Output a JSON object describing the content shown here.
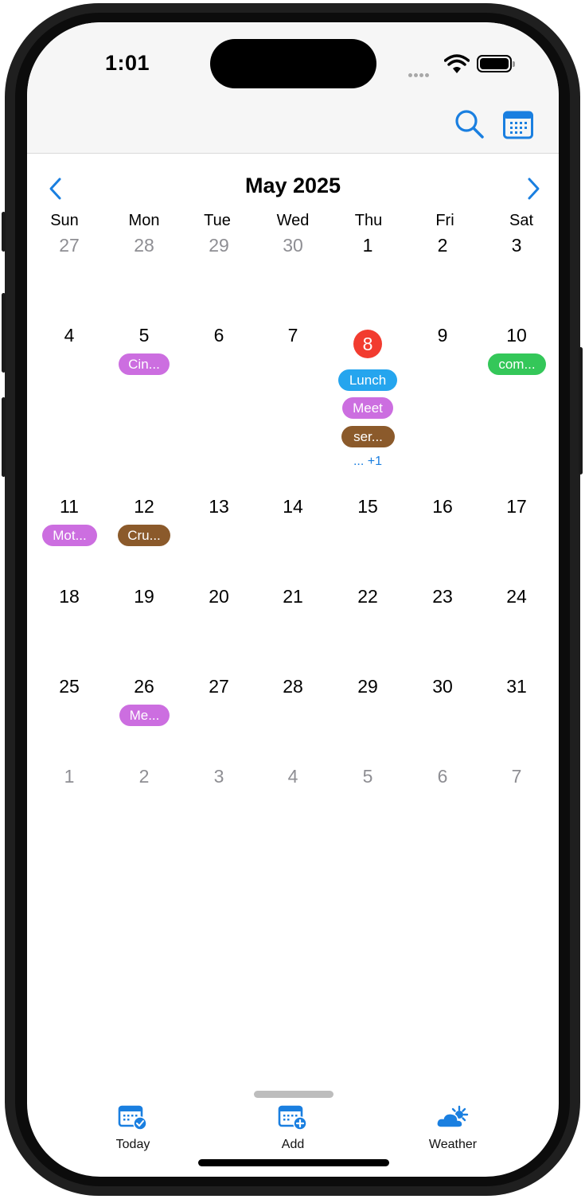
{
  "status_bar": {
    "time": "1:01"
  },
  "header": {
    "search_icon": "search-icon",
    "calendar_icon": "calendar-icon"
  },
  "calendar": {
    "month_title": "May 2025",
    "weekdays": [
      "Sun",
      "Mon",
      "Tue",
      "Wed",
      "Thu",
      "Fri",
      "Sat"
    ],
    "weeks": [
      [
        "27",
        "28",
        "29",
        "30",
        "1",
        "2",
        "3"
      ],
      [
        "4",
        "5",
        "6",
        "7",
        "8",
        "9",
        "10"
      ],
      [
        "11",
        "12",
        "13",
        "14",
        "15",
        "16",
        "17"
      ],
      [
        "18",
        "19",
        "20",
        "21",
        "22",
        "23",
        "24"
      ],
      [
        "25",
        "26",
        "27",
        "28",
        "29",
        "30",
        "31"
      ],
      [
        "1",
        "2",
        "3",
        "4",
        "5",
        "6",
        "7"
      ]
    ],
    "muted_days": {
      "first_week": [
        "27",
        "28",
        "29",
        "30"
      ],
      "last_week": [
        "1",
        "2",
        "3",
        "4",
        "5",
        "6",
        "7"
      ]
    },
    "today": "8",
    "events": [
      {
        "day": "5",
        "label": "Cin...",
        "color": "#cc6ee0"
      },
      {
        "day": "8",
        "label": "Lunch",
        "color": "#25a5ee"
      },
      {
        "day": "8",
        "label": "Meet",
        "color": "#cc6ee0"
      },
      {
        "day": "8",
        "label": "ser...",
        "color": "#8b5a2b"
      },
      {
        "day": "10",
        "label": "com...",
        "color": "#34c759"
      },
      {
        "day": "11",
        "label": "Mot...",
        "color": "#cc6ee0"
      },
      {
        "day": "12",
        "label": "Cru...",
        "color": "#8b5a2b"
      },
      {
        "day": "26",
        "label": "Me...",
        "color": "#cc6ee0"
      }
    ],
    "more_indicator": "... +1",
    "accent_color": "#1a7fe0",
    "today_color": "#f23b2f"
  },
  "tabbar": {
    "today_label": "Today",
    "add_label": "Add",
    "weather_label": "Weather"
  }
}
